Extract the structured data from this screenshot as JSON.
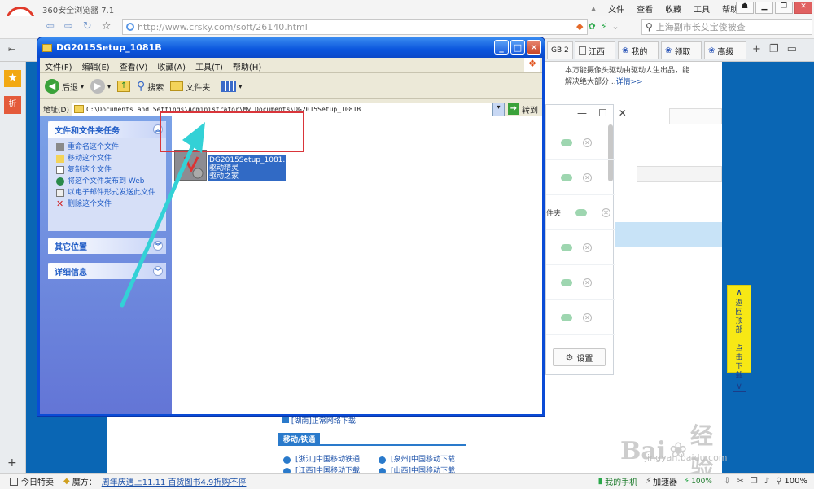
{
  "browser": {
    "title": "360安全浏览器 7.1",
    "menu": [
      "文件",
      "查看",
      "收藏",
      "工具",
      "帮助"
    ],
    "url": "http://www.crsky.com/soft/26140.html",
    "search_text": "上海副市长艾宝俊被查",
    "new_badge": "NEW",
    "tabs": [
      {
        "label": "GB 2"
      },
      {
        "label": "江西"
      },
      {
        "label": "我的"
      },
      {
        "label": "领取"
      },
      {
        "label": "高级"
      }
    ],
    "left_rail": {
      "fold_label": "折"
    },
    "status": {
      "today_deals": "今日特卖",
      "magic_label": "魔方：",
      "promo_link": "周年庆遇上11.11 百货图书4.9折购不停",
      "my_phone": "我的手机",
      "accelerator": "加速器",
      "percent_small": "100%",
      "zoom": "100%"
    }
  },
  "page_bg": {
    "blurb_line1": "本万能摄像头驱动由驱动人生出品，能",
    "blurb_line2": "解决绝大部分...",
    "details_link": "详情>>",
    "hunan_link": "[湖南]正常网络下载",
    "section_title": "移动/铁通",
    "links": [
      "[浙江]中国移动铁通",
      "[泉州]中国移动下载",
      "[江西]中国移动下载",
      "[山西]中国移动下载"
    ],
    "watermark_big": "Bai",
    "watermark_cn": "经验",
    "watermark_url": "jingyan.baidu.com",
    "partial_text": "件夹"
  },
  "floating_panel": {
    "settings_label": "设置"
  },
  "side_float": {
    "back_top": "返回顶部",
    "click_download": "点击下载"
  },
  "explorer": {
    "title": "DG2015Setup_1081B",
    "menu": [
      "文件(F)",
      "编辑(E)",
      "查看(V)",
      "收藏(A)",
      "工具(T)",
      "帮助(H)"
    ],
    "toolbar": {
      "back": "后退",
      "search": "搜索",
      "folders": "文件夹"
    },
    "address_label": "地址(D)",
    "address_value": "C:\\Documents and Settings\\Administrator\\My Documents\\DG2015Setup_1081B",
    "go_label": "转到",
    "tasks_panel": {
      "title": "文件和文件夹任务",
      "items": [
        "重命名这个文件",
        "移动这个文件",
        "复制这个文件",
        "将这个文件发布到 Web",
        "以电子邮件形式发送此文件",
        "删除这个文件"
      ]
    },
    "other_places": "其它位置",
    "details": "详细信息",
    "file": {
      "name": "DG2015Setup_1081...",
      "line2": "驱动精灵",
      "line3": "驱动之家"
    }
  },
  "colors": {
    "page_blue": "#0a66b4",
    "xp_blue": "#0a55dd",
    "highlight_red": "#d9353a",
    "arrow_cyan": "#33d1d6",
    "float_yellow": "#f7e815"
  }
}
